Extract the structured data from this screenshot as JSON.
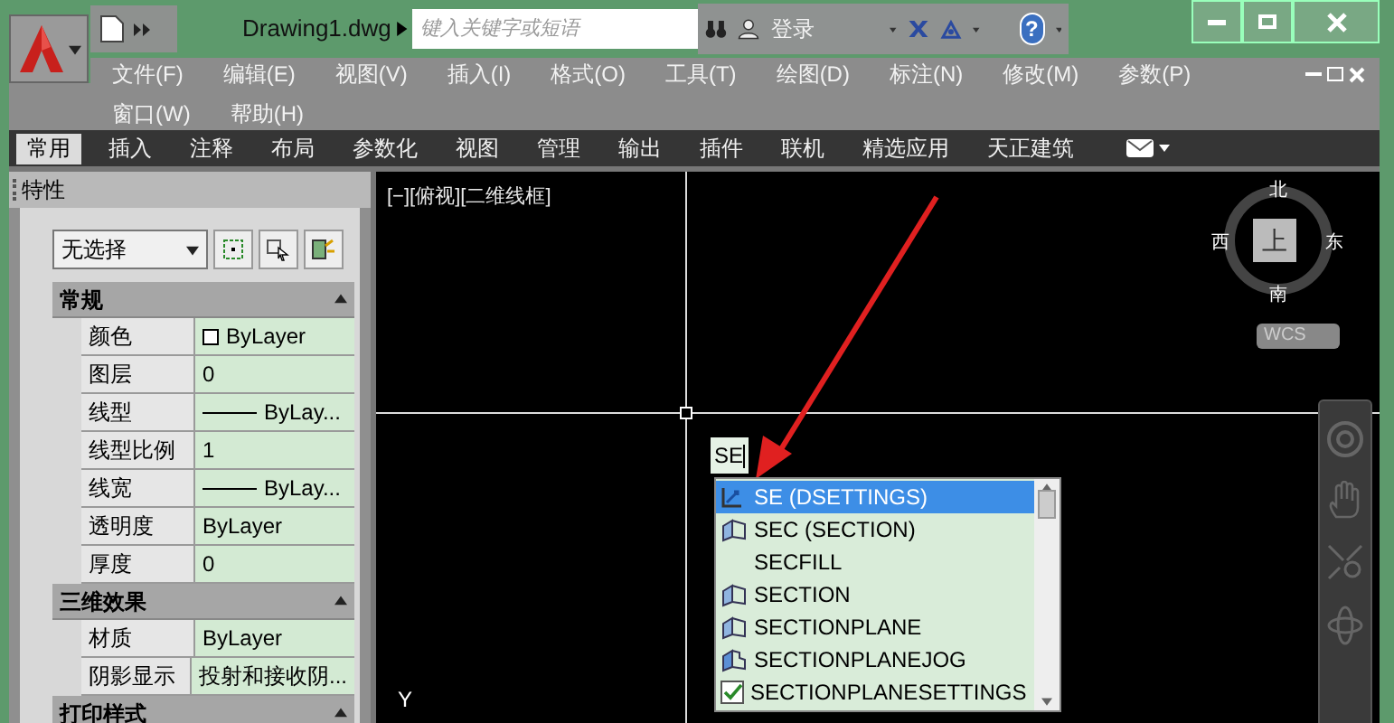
{
  "title_bar": {
    "title": "Drawing1.dwg",
    "search": {
      "placeholder": "键入关键字或短语"
    },
    "login": "登录",
    "help": "?"
  },
  "menu_bar": {
    "rows": [
      [
        "文件(F)",
        "编辑(E)",
        "视图(V)",
        "插入(I)",
        "格式(O)",
        "工具(T)",
        "绘图(D)",
        "标注(N)",
        "修改(M)",
        "参数(P)"
      ],
      [
        "窗口(W)",
        "帮助(H)"
      ]
    ]
  },
  "ribbon_tabs": [
    {
      "label": "常用",
      "selected": true
    },
    {
      "label": "插入",
      "selected": false
    },
    {
      "label": "注释",
      "selected": false
    },
    {
      "label": "布局",
      "selected": false
    },
    {
      "label": "参数化",
      "selected": false
    },
    {
      "label": "视图",
      "selected": false
    },
    {
      "label": "管理",
      "selected": false
    },
    {
      "label": "输出",
      "selected": false
    },
    {
      "label": "插件",
      "selected": false
    },
    {
      "label": "联机",
      "selected": false
    },
    {
      "label": "精选应用",
      "selected": false
    },
    {
      "label": "天正建筑",
      "selected": false
    }
  ],
  "properties": {
    "title": "特性",
    "selection": "无选择",
    "sections": [
      {
        "title": "常规",
        "expanded": true,
        "rows": [
          {
            "label": "颜色",
            "value": "ByLayer",
            "kind": "color"
          },
          {
            "label": "图层",
            "value": "0",
            "kind": "text"
          },
          {
            "label": "线型",
            "value": "ByLay...",
            "kind": "linetype"
          },
          {
            "label": "线型比例",
            "value": "1",
            "kind": "text"
          },
          {
            "label": "线宽",
            "value": "ByLay...",
            "kind": "linetype"
          },
          {
            "label": "透明度",
            "value": "ByLayer",
            "kind": "text"
          },
          {
            "label": "厚度",
            "value": "0",
            "kind": "text"
          }
        ]
      },
      {
        "title": "三维效果",
        "expanded": true,
        "rows": [
          {
            "label": "材质",
            "value": "ByLayer",
            "kind": "text"
          },
          {
            "label": "阴影显示",
            "value": "投射和接收阴...",
            "kind": "text"
          }
        ]
      },
      {
        "title": "打印样式",
        "expanded": true
      }
    ]
  },
  "viewport": {
    "label": "[−][俯视][二维线框]",
    "command_input": "SE",
    "autocomplete": [
      {
        "label": "SE (DSETTINGS)",
        "kind": "dsettings",
        "selected": true
      },
      {
        "label": "SEC (SECTION)",
        "kind": "section",
        "selected": false
      },
      {
        "label": "SECFILL",
        "kind": "none",
        "selected": false
      },
      {
        "label": "SECTION",
        "kind": "section",
        "selected": false
      },
      {
        "label": "SECTIONPLANE",
        "kind": "section",
        "selected": false
      },
      {
        "label": "SECTIONPLANEJOG",
        "kind": "jog",
        "selected": false
      },
      {
        "label": "SECTIONPLANESETTINGS",
        "kind": "check",
        "selected": false
      }
    ],
    "viewcube": {
      "north": "北",
      "west": "西",
      "face": "上",
      "east": "东",
      "south": "南",
      "wcs": "WCS"
    },
    "axis_label": "Y"
  }
}
